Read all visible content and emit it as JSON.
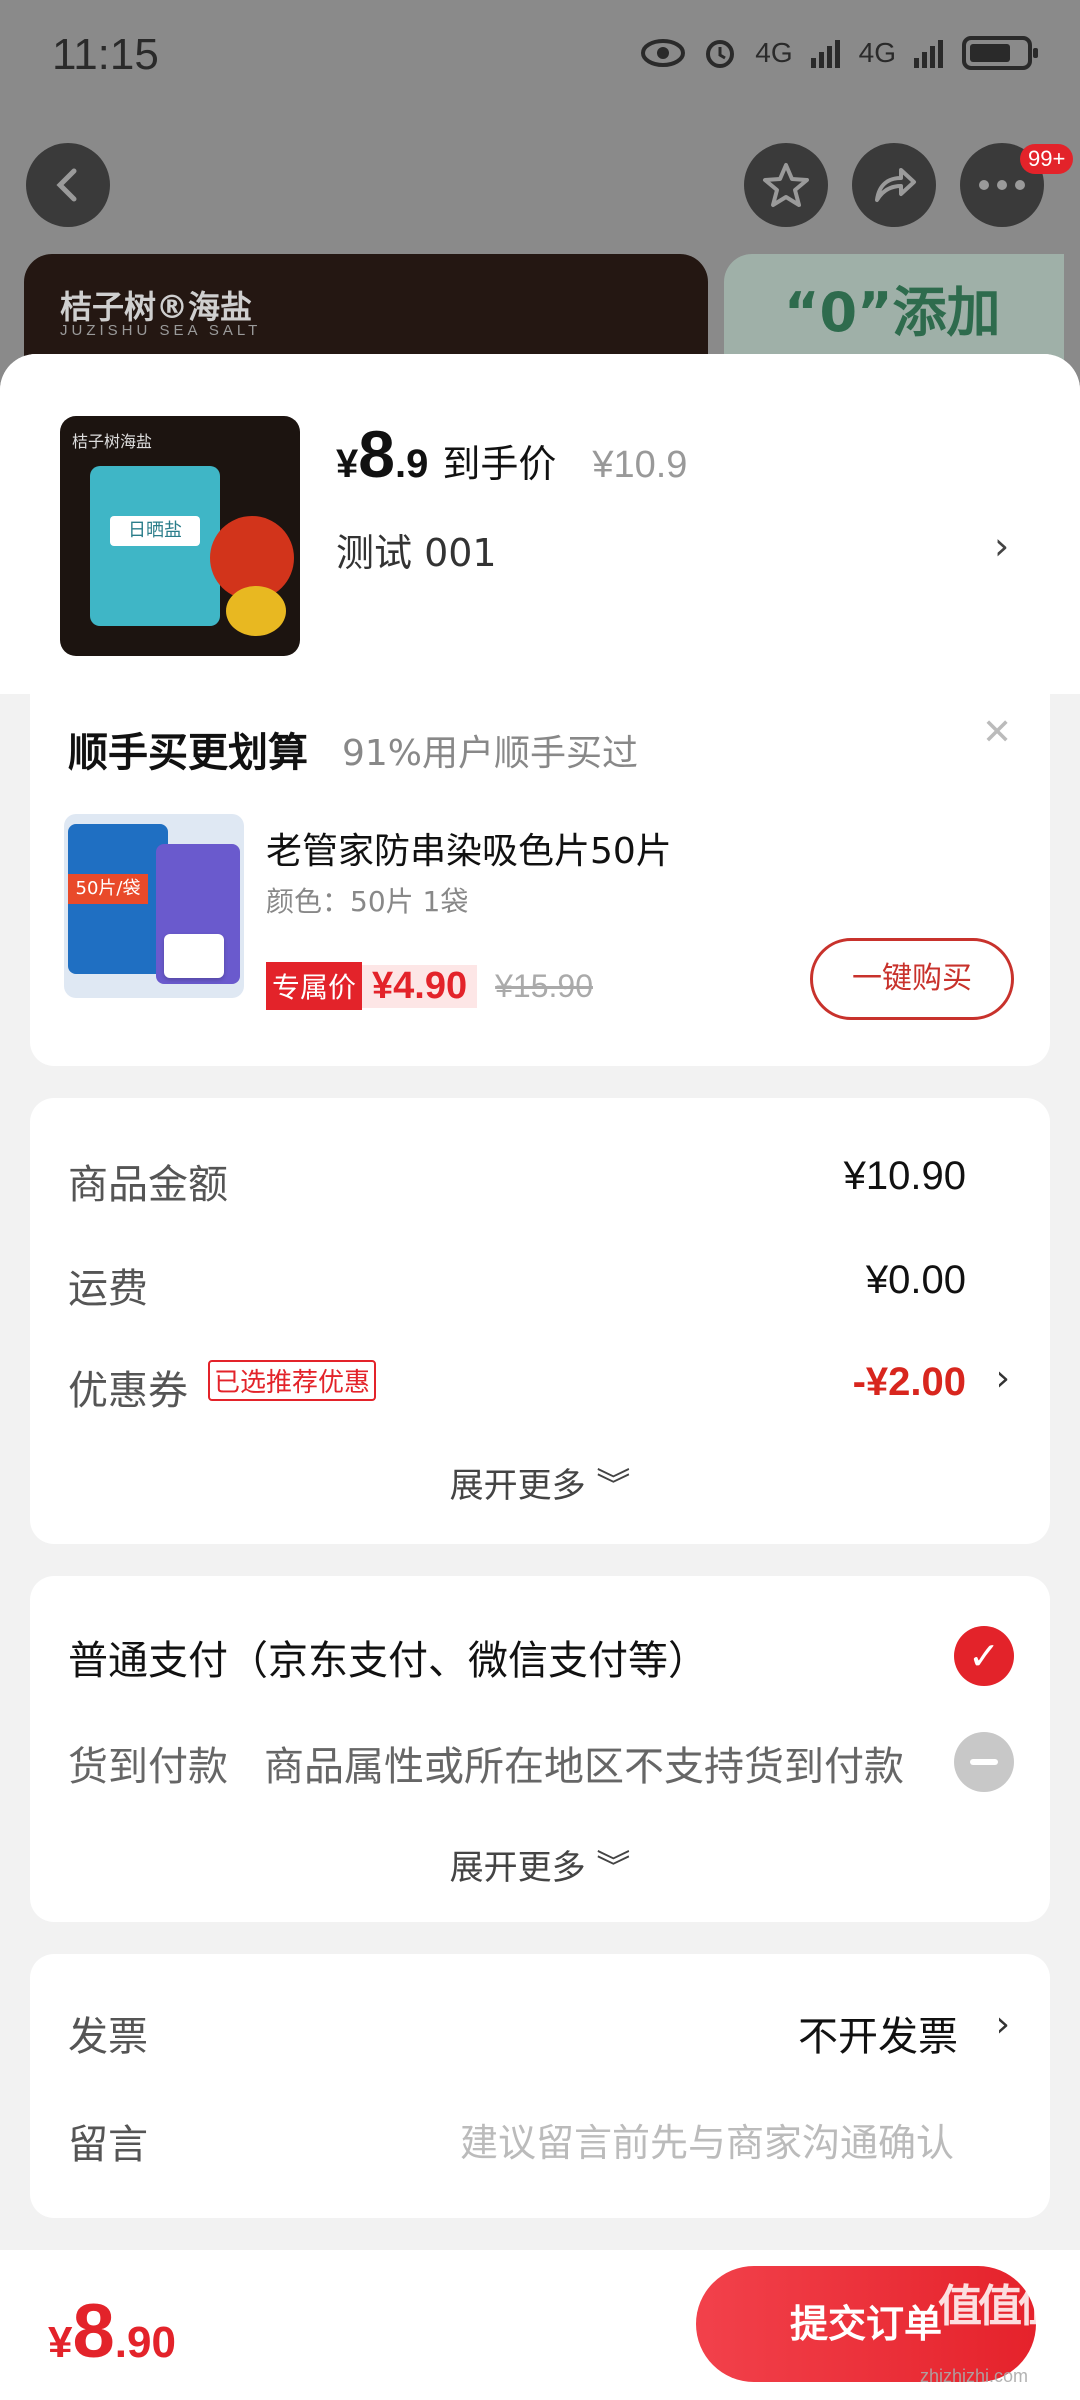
{
  "status_bar": {
    "time": "11:15",
    "network1": "4G",
    "network2": "4G"
  },
  "background": {
    "badge": "99+",
    "banner_brand": "桔子树®海盐",
    "banner_sub": "JUZISHU SEA SALT",
    "banner_right_text": "“0”添加"
  },
  "product": {
    "image_brand": "桔子树海盐",
    "image_label": "日晒盐",
    "price_symbol": "¥",
    "price_int": "8",
    "price_dec": ".9",
    "price_label": "到手价",
    "original_price": "¥10.9",
    "variant": "测试  001",
    "close_glyph": "✕",
    "chevron": "›"
  },
  "bundle": {
    "title": "顺手买更划算",
    "subtitle": "91%用户顺手买过",
    "close_glyph": "✕",
    "pack_tag": "50片/袋",
    "item_name": "老管家防串染吸色片50片",
    "item_spec": "颜色：50片 1袋",
    "exclusive_label": "专属价",
    "exclusive_price": "¥4.90",
    "original_price": "¥15.90",
    "buy_button": "一键购买"
  },
  "amounts": {
    "goods_label": "商品金额",
    "goods_value": "¥10.90",
    "shipping_label": "运费",
    "shipping_value": "¥0.00",
    "coupon_label": "优惠券",
    "coupon_tag": "已选推荐优惠",
    "coupon_value": "-¥2.00",
    "chevron": "›",
    "expand_more": "展开更多 ︾"
  },
  "payment": {
    "normal": "普通支付（京东支付、微信支付等）",
    "check_glyph": "✓",
    "cod_label": "货到付款",
    "cod_note": "商品属性或所在地区不支持货到付款",
    "expand_more": "展开更多 ︾"
  },
  "invoice": {
    "invoice_label": "发票",
    "invoice_value": "不开发票",
    "chevron": "›",
    "note_label": "留言",
    "note_placeholder": "建议留言前先与商家沟通确认"
  },
  "footer": {
    "total_symbol": "¥",
    "total_int": "8",
    "total_dec": ".90",
    "submit": "提交订单",
    "watermark": "值值值",
    "watermark_sub": "zhizhizhi.com"
  },
  "colors": {
    "accent_red": "#e3232a",
    "price_red": "#d8261e",
    "dim_overlay": "#8a8a8a"
  }
}
